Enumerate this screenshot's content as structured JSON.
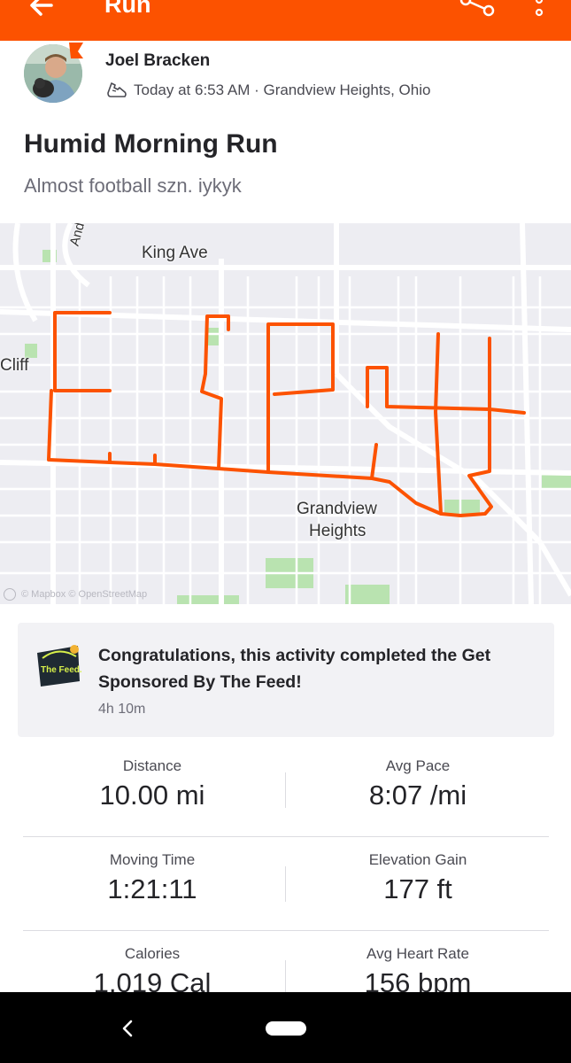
{
  "header": {
    "title": "Run"
  },
  "athlete": {
    "name": "Joel Bracken",
    "meta": "Today at 6:53 AM · Grandview Heights, Ohio"
  },
  "activity": {
    "title": "Humid Morning Run",
    "description": "Almost football szn. iykyk"
  },
  "map": {
    "labels": {
      "king_ave": "King Ave",
      "cliff": "Cliff",
      "grandview_1": "Grandview",
      "grandview_2": "Heights",
      "road_partial": "And"
    },
    "attribution": "© Mapbox © OpenStreetMap",
    "route_color": "#fc5200"
  },
  "challenge": {
    "text": "Congratulations, this activity completed the Get Sponsored By The Feed!",
    "time": "4h 10m",
    "logo_text": "The Feed."
  },
  "stats": [
    {
      "label": "Distance",
      "value": "10.00 mi"
    },
    {
      "label": "Avg Pace",
      "value": "8:07 /mi"
    },
    {
      "label": "Moving Time",
      "value": "1:21:11"
    },
    {
      "label": "Elevation Gain",
      "value": "177 ft"
    },
    {
      "label": "Calories",
      "value": "1,019 Cal"
    },
    {
      "label": "Avg Heart Rate",
      "value": "156 bpm"
    }
  ],
  "colors": {
    "brand": "#fc5200",
    "text": "#242428",
    "muted": "#6d6d78"
  },
  "icons": {
    "back": "arrow-left-icon",
    "share": "share-icon",
    "more": "more-vertical-icon",
    "shoe": "shoe-icon",
    "nav_back": "chevron-left-icon",
    "nav_home": "home-pill-icon"
  }
}
